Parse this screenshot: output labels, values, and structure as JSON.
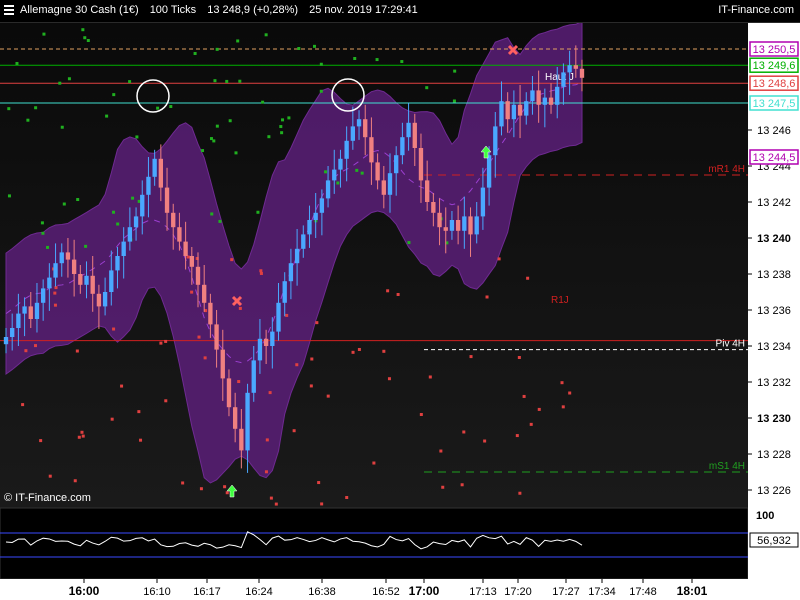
{
  "header": {
    "instrument": "Allemagne 30 Cash (1€)",
    "ticks": "100 Ticks",
    "price": "13 248,9 (+0,28%)",
    "datetime": "25 nov. 2019 17:29:41",
    "brand": "IT-Finance.com",
    "watermark": "© IT-Finance.com"
  },
  "chart_data": {
    "type": "candlestick",
    "ylim": [
      13225,
      13252
    ],
    "y_ticks": [
      "13 246",
      "13 244",
      "13 242",
      "13 240",
      "13 238",
      "13 236",
      "13 234",
      "13 232",
      "13 230",
      "13 228",
      "13 226"
    ],
    "y_tick_values": [
      13246,
      13244,
      13242,
      13240,
      13238,
      13236,
      13234,
      13232,
      13230,
      13228,
      13226
    ],
    "x_ticks": [
      "16:00",
      "16:10",
      "16:17",
      "16:24",
      "16:38",
      "16:52",
      "17:00",
      "17:13",
      "17:20",
      "17:27",
      "17:34",
      "17:48",
      "18:01"
    ],
    "price_boxes": [
      {
        "label": "13 250,5",
        "value": 13250.5,
        "color": "#b000b0"
      },
      {
        "label": "13 249,6",
        "value": 13249.6,
        "color": "#00b000"
      },
      {
        "label": "13 248,6",
        "value": 13248.6,
        "color": "#e04040"
      },
      {
        "label": "13 247,5",
        "value": 13247.5,
        "color": "#40e0d0"
      },
      {
        "label": "13 244,5",
        "value": 13244.5,
        "color": "#b000b0"
      }
    ],
    "levels": [
      {
        "label": "mR1 4H",
        "value": 13243.5,
        "color": "#d02020"
      },
      {
        "label": "Piv 4H",
        "value": 13233.8,
        "color": "#ffffff"
      },
      {
        "label": "mS1 4H",
        "value": 13227.0,
        "color": "#20a020"
      }
    ],
    "annotations": [
      "Haut J",
      "R1J"
    ],
    "closes": [
      13234.5,
      13235.0,
      13235.8,
      13236.2,
      13235.5,
      13236.4,
      13237.2,
      13237.8,
      13238.6,
      13239.2,
      13238.8,
      13238.0,
      13237.4,
      13237.9,
      13236.9,
      13236.2,
      13237.0,
      13238.2,
      13239.0,
      13239.8,
      13240.6,
      13241.2,
      13242.4,
      13243.4,
      13244.4,
      13242.8,
      13241.4,
      13240.6,
      13239.8,
      13239.0,
      13238.4,
      13237.4,
      13236.4,
      13235.2,
      13233.8,
      13232.2,
      13230.6,
      13229.4,
      13228.2,
      13231.4,
      13233.2,
      13234.4,
      13234.0,
      13234.8,
      13236.4,
      13237.6,
      13238.6,
      13239.4,
      13240.2,
      13241.0,
      13241.4,
      13242.2,
      13243.2,
      13243.8,
      13244.4,
      13245.4,
      13246.2,
      13246.6,
      13245.6,
      13244.2,
      13243.2,
      13242.4,
      13243.6,
      13244.6,
      13245.6,
      13246.4,
      13245.0,
      13243.2,
      13242.0,
      13241.4,
      13240.6,
      13240.4,
      13241.0,
      13240.4,
      13241.2,
      13240.2,
      13241.2,
      13242.8,
      13244.6,
      13246.2,
      13247.6,
      13246.6,
      13247.4,
      13246.8,
      13247.6,
      13248.2,
      13247.4,
      13247.8,
      13247.4,
      13248.4,
      13249.2,
      13249.6,
      13249.4,
      13248.9
    ],
    "oscillator": {
      "ylabel": "100",
      "current": "56,932"
    }
  }
}
